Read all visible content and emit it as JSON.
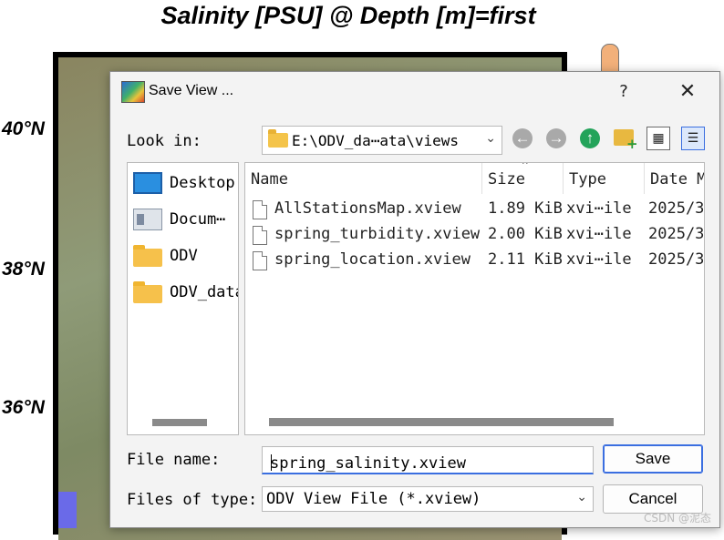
{
  "plot": {
    "title": "Salinity [PSU] @ Depth [m]=first",
    "lat_labels": [
      "40°N",
      "38°N",
      "36°N"
    ]
  },
  "dialog": {
    "title": "Save View ...",
    "help": "?",
    "close": "✕",
    "look_in_label": "Look in:",
    "path": "E:\\ODV_da⋯ata\\views",
    "sidebar": {
      "items": [
        {
          "label": "Desktop",
          "icon": "desktop-icon"
        },
        {
          "label": "Docum⋯",
          "icon": "documents-icon"
        },
        {
          "label": "ODV",
          "icon": "folder-icon"
        },
        {
          "label": "ODV_data",
          "icon": "folder-icon"
        }
      ]
    },
    "columns": [
      "Name",
      "Size",
      "Type",
      "Date M"
    ],
    "files": [
      {
        "name": "AllStationsMap.xview",
        "size": "1.89 KiB",
        "type": "xvi⋯ile",
        "date": "2025/3"
      },
      {
        "name": "spring_turbidity.xview",
        "size": "2.00 KiB",
        "type": "xvi⋯ile",
        "date": "2025/3"
      },
      {
        "name": "spring_location.xview",
        "size": "2.11 KiB",
        "type": "xvi⋯ile",
        "date": "2025/3"
      }
    ],
    "file_name_label": "File name:",
    "file_name_value": "spring_salinity.xview",
    "file_type_label": "Files of type:",
    "file_type_value": "ODV View File (*.xview)",
    "save_label": "Save",
    "cancel_label": "Cancel"
  },
  "watermark": "CSDN @泥态",
  "colors": {
    "accent": "#3a6ee0",
    "folder": "#f6c14b",
    "up_arrow": "#23a35a"
  }
}
